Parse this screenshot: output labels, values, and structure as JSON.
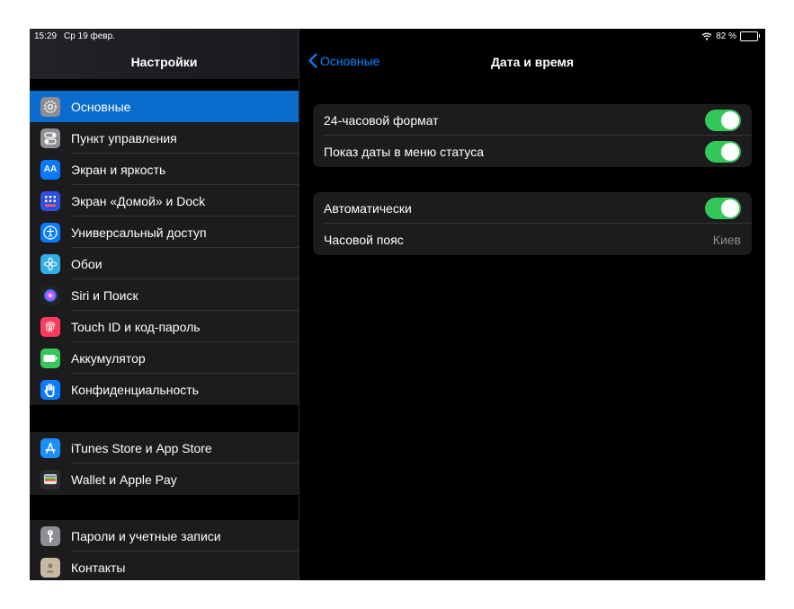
{
  "status": {
    "time": "15:29",
    "date": "Ср 19 февр.",
    "battery": "82 %",
    "battery_level": 0.82
  },
  "sidebar": {
    "title": "Настройки",
    "group1": [
      {
        "label": "Основные",
        "icon": "gear-icon",
        "color": "#8e8e93"
      },
      {
        "label": "Пункт управления",
        "icon": "toggles-icon",
        "color": "#8e8e93"
      },
      {
        "label": "Экран и яркость",
        "icon": "text-size-icon",
        "color": "#0a7aff"
      },
      {
        "label": "Экран «Домой» и Dock",
        "icon": "home-grid-icon",
        "color": "#2f4fe0"
      },
      {
        "label": "Универсальный доступ",
        "icon": "accessibility-icon",
        "color": "#0a7aff"
      },
      {
        "label": "Обои",
        "icon": "wallpaper-flower-icon",
        "color": "#32ade6"
      },
      {
        "label": "Siri и Поиск",
        "icon": "siri-icon",
        "color": "#222"
      },
      {
        "label": "Touch ID и код-пароль",
        "icon": "fingerprint-icon",
        "color": "#ff3b5c"
      },
      {
        "label": "Аккумулятор",
        "icon": "battery-icon",
        "color": "#34c759"
      },
      {
        "label": "Конфиденциальность",
        "icon": "hand-icon",
        "color": "#0a7aff"
      }
    ],
    "group2": [
      {
        "label": "iTunes Store и App Store",
        "icon": "app-store-icon",
        "color": "#1c8ef9"
      },
      {
        "label": "Wallet и Apple Pay",
        "icon": "wallet-icon",
        "color": "#2c2c2e"
      }
    ],
    "group3": [
      {
        "label": "Пароли и учетные записи",
        "icon": "key-icon",
        "color": "#8e8e93"
      },
      {
        "label": "Контакты",
        "icon": "contacts-icon",
        "color": "#c7b9a3"
      }
    ]
  },
  "detail": {
    "back_label": "Основные",
    "title": "Дата и время",
    "section1": {
      "format_label": "24-часовой формат",
      "format_on": true,
      "status_date_label": "Показ даты в меню статуса",
      "status_date_on": true
    },
    "section2": {
      "auto_label": "Автоматически",
      "auto_on": true,
      "timezone_label": "Часовой пояс",
      "timezone_value": "Киев"
    }
  }
}
